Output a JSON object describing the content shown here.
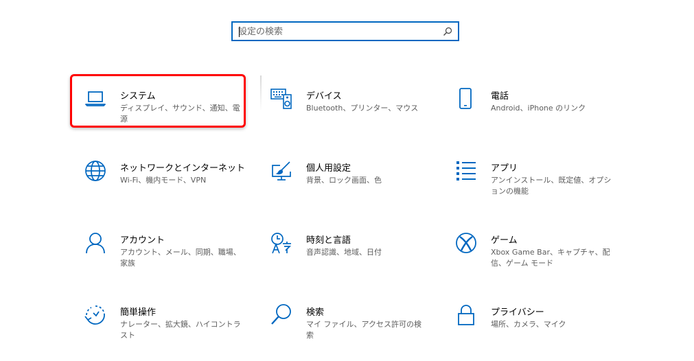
{
  "search": {
    "placeholder": "設定の検索",
    "icon": "search-icon"
  },
  "accent_color": "#0067c0",
  "highlight_color": "#ff0000",
  "tiles": [
    {
      "title": "システム",
      "desc": "ディスプレイ、サウンド、通知、電源",
      "icon": "laptop-icon"
    },
    {
      "title": "デバイス",
      "desc": "Bluetooth、プリンター、マウス",
      "icon": "keyboard-speaker-icon"
    },
    {
      "title": "電話",
      "desc": "Android、iPhone のリンク",
      "icon": "phone-icon"
    },
    {
      "title": "ネットワークとインターネット",
      "desc": "Wi-Fi、機内モード、VPN",
      "icon": "globe-icon"
    },
    {
      "title": "個人用設定",
      "desc": "背景、ロック画面、色",
      "icon": "brush-monitor-icon"
    },
    {
      "title": "アプリ",
      "desc": "アンインストール、既定値、オプションの機能",
      "icon": "app-list-icon"
    },
    {
      "title": "アカウント",
      "desc": "アカウント、メール、同期、職場、家族",
      "icon": "person-icon"
    },
    {
      "title": "時刻と言語",
      "desc": "音声認識、地域、日付",
      "icon": "time-language-icon"
    },
    {
      "title": "ゲーム",
      "desc": "Xbox Game Bar、キャプチャ、配信、ゲーム モード",
      "icon": "xbox-icon"
    },
    {
      "title": "簡単操作",
      "desc": "ナレーター、拡大鏡、ハイコントラスト",
      "icon": "ease-of-access-icon"
    },
    {
      "title": "検索",
      "desc": "マイ ファイル、アクセス許可の検索",
      "icon": "magnifier-icon"
    },
    {
      "title": "プライバシー",
      "desc": "場所、カメラ、マイク",
      "icon": "lock-icon"
    }
  ]
}
